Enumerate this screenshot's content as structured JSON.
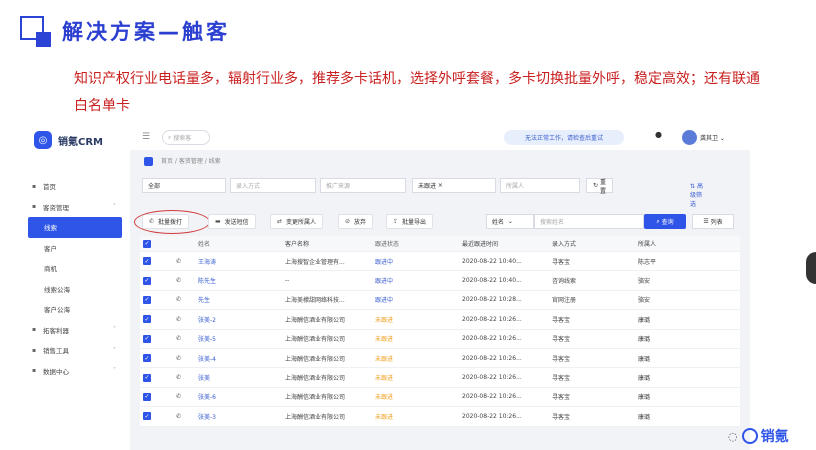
{
  "slide": {
    "title": "解决方案—触客",
    "description": "知识产权行业电话量多，辐射行业多，推荐多卡话机，选择外呼套餐，多卡切换批量外呼，稳定高效；还有联通白名单卡"
  },
  "app": {
    "brand": "销氪CRM",
    "brand_icon": "crm-logo-icon",
    "topbar": {
      "search_placeholder": "搜索客",
      "notice": "无法正常工作，请检查后重试",
      "user_name": "龚其卫"
    },
    "breadcrumb": "首页 / 客资管理 / 线索",
    "sidebar": [
      {
        "label": "首页",
        "icon": "home-icon",
        "level": 0
      },
      {
        "label": "客资管理",
        "icon": "folder-icon",
        "level": 0,
        "expanded": true
      },
      {
        "label": "线索",
        "level": 1,
        "active": true
      },
      {
        "label": "客户",
        "level": 1
      },
      {
        "label": "商机",
        "level": 1
      },
      {
        "label": "线索公海",
        "level": 1
      },
      {
        "label": "客户公海",
        "level": 1
      },
      {
        "label": "拓客利器",
        "icon": "grid-icon",
        "level": 0,
        "arrow": true
      },
      {
        "label": "销售工具",
        "icon": "tools-icon",
        "level": 0,
        "arrow": true
      },
      {
        "label": "数据中心",
        "icon": "chart-icon",
        "level": 0,
        "arrow": true
      }
    ],
    "filters": {
      "all": "全部",
      "source_placeholder": "录入方式",
      "promo_placeholder": "推广来源",
      "status": "未跟进",
      "owner_placeholder": "所属人",
      "reset": "重置",
      "advanced": "高级筛选"
    },
    "actions": {
      "batch_call": "批量拨打",
      "send_sms": "发送短信",
      "change_owner": "变更所属人",
      "abandon": "放弃",
      "export": "批量导出",
      "name_field": "姓名",
      "name_placeholder": "搜索姓名",
      "query": "查询",
      "list": "列表"
    },
    "table": {
      "headers": [
        "姓名",
        "客户名称",
        "跟进状态",
        "最近跟进时间",
        "录入方式",
        "所属人"
      ],
      "rows": [
        {
          "name": "王海涛",
          "company": "上海搜智企业管理有...",
          "status": "跟进中",
          "orange": false,
          "time": "2020-08-22 10:40...",
          "source": "寻客宝",
          "owner": "陈志平"
        },
        {
          "name": "陈先生",
          "company": "--",
          "status": "跟进中",
          "orange": false,
          "time": "2020-08-22 10:40...",
          "source": "咨询线索",
          "owner": "骆安"
        },
        {
          "name": "先生",
          "company": "上海美檬甜网络科技...",
          "status": "跟进中",
          "orange": false,
          "time": "2020-08-22 10:28...",
          "source": "官网注册",
          "owner": "骆安"
        },
        {
          "name": "张美-2",
          "company": "上海酬信酒业有限公司",
          "status": "未跟进",
          "orange": true,
          "time": "2020-08-22 10:26...",
          "source": "寻客宝",
          "owner": "康璐"
        },
        {
          "name": "张美-5",
          "company": "上海酬信酒业有限公司",
          "status": "未跟进",
          "orange": true,
          "time": "2020-08-22 10:26...",
          "source": "寻客宝",
          "owner": "康璐"
        },
        {
          "name": "张美-4",
          "company": "上海酬信酒业有限公司",
          "status": "未跟进",
          "orange": true,
          "time": "2020-08-22 10:26...",
          "source": "寻客宝",
          "owner": "康璐"
        },
        {
          "name": "张美",
          "company": "上海酬信酒业有限公司",
          "status": "未跟进",
          "orange": true,
          "time": "2020-08-22 10:26...",
          "source": "寻客宝",
          "owner": "康璐"
        },
        {
          "name": "张美-6",
          "company": "上海酬信酒业有限公司",
          "status": "未跟进",
          "orange": true,
          "time": "2020-08-22 10:26...",
          "source": "寻客宝",
          "owner": "康璐"
        },
        {
          "name": "张美-3",
          "company": "上海酬信酒业有限公司",
          "status": "未跟进",
          "orange": true,
          "time": "2020-08-22 10:26...",
          "source": "寻客宝",
          "owner": "康璐"
        }
      ]
    }
  },
  "watermark": {
    "text": "销氪"
  },
  "colors": {
    "primary": "#2f55e8",
    "title": "#2b3fd0",
    "desc": "#c8201f",
    "pending": "#f0a020",
    "circle": "#d23b3b"
  }
}
